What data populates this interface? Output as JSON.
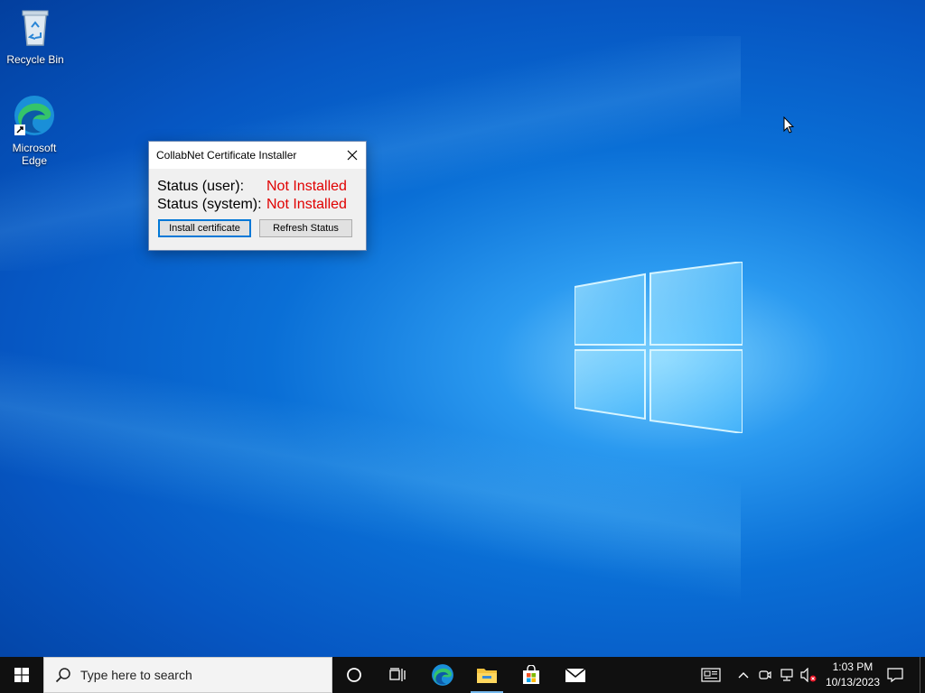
{
  "desktop": {
    "icons": [
      {
        "label": "Recycle Bin",
        "icon": "recycle-bin-icon"
      },
      {
        "label": "Microsoft Edge",
        "icon": "edge-icon"
      }
    ]
  },
  "dialog": {
    "title": "CollabNet Certificate Installer",
    "status_user_label": "Status (user):",
    "status_user_value": "Not Installed",
    "status_system_label": "Status (system):",
    "status_system_value": "Not Installed",
    "install_button": "Install certificate",
    "refresh_button": "Refresh Status",
    "status_color": "#e00000"
  },
  "taskbar": {
    "search_placeholder": "Type here to search",
    "time": "1:03 PM",
    "date": "10/13/2023",
    "pinned": [
      "cortana-icon",
      "task-view-icon",
      "edge-icon",
      "file-explorer-icon",
      "store-icon",
      "mail-icon"
    ],
    "tray": [
      "news-icon",
      "chevron-up-icon",
      "meet-now-icon",
      "network-icon",
      "volume-muted-icon",
      "notification-icon"
    ]
  },
  "colors": {
    "accent": "#0078d7",
    "taskbar": "#101010"
  }
}
